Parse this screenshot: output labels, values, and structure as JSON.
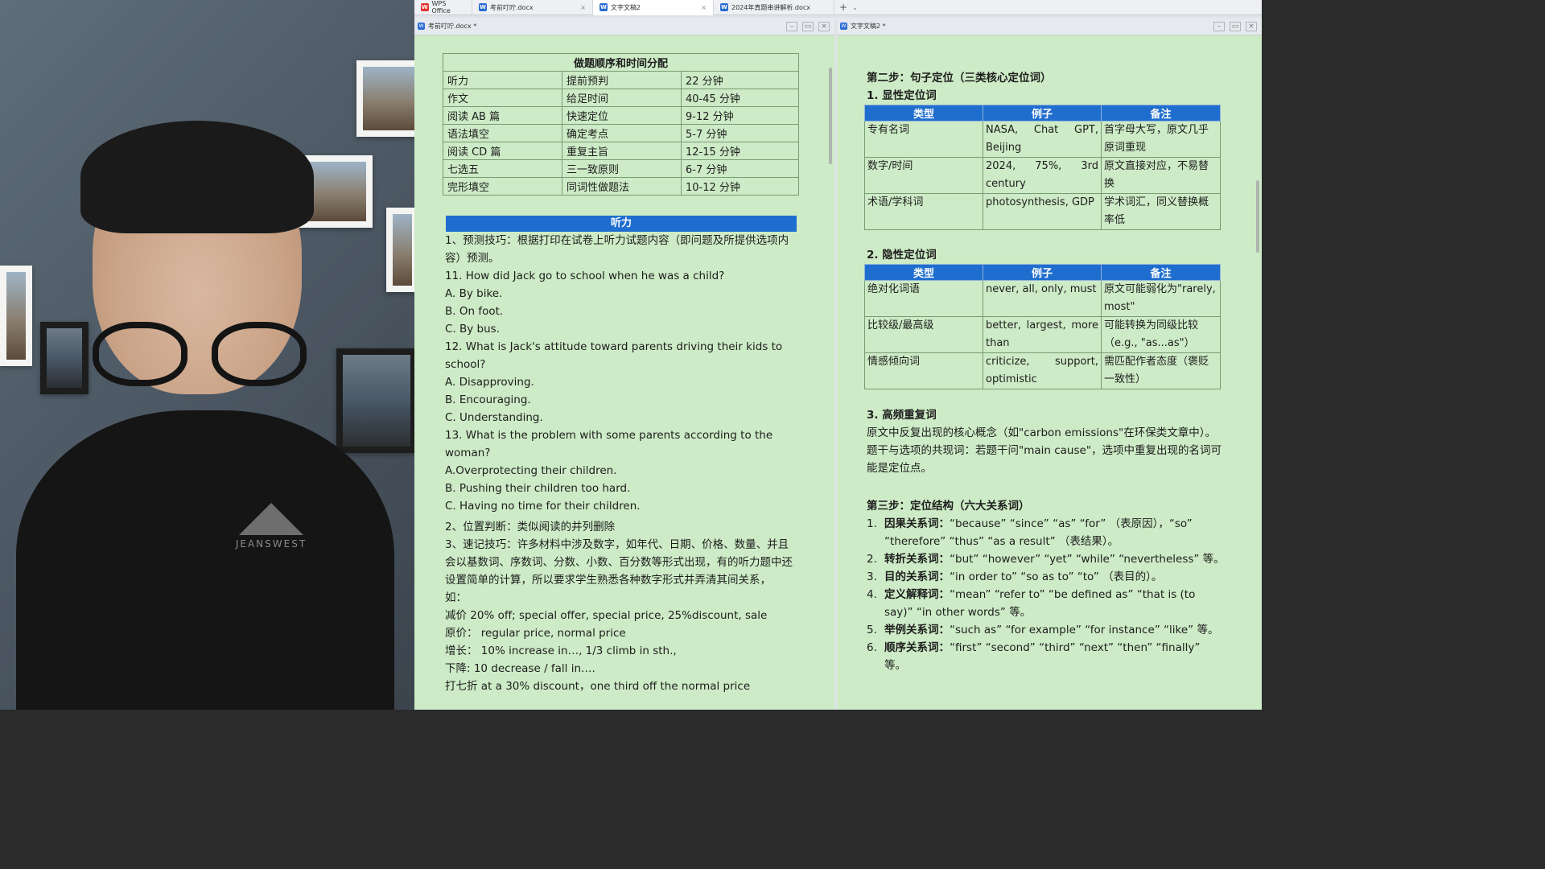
{
  "tabs": [
    {
      "label": "WPS Office",
      "icon": "wps-logo-icon"
    },
    {
      "label": "考前叮咛.docx",
      "icon": "word-doc-icon"
    },
    {
      "label": "文字文稿2",
      "icon": "word-doc-icon"
    },
    {
      "label": "2024年真题串讲解析.docx",
      "icon": "word-doc-icon"
    }
  ],
  "left_pane": {
    "title": "考前叮咛.docx *",
    "table": {
      "caption": "做题顺序和时间分配",
      "rows": [
        [
          "听力",
          "提前预判",
          "22 分钟"
        ],
        [
          "作文",
          "给足时间",
          "40-45 分钟"
        ],
        [
          "阅读 AB 篇",
          "快速定位",
          "9-12 分钟"
        ],
        [
          "语法填空",
          "确定考点",
          "5-7 分钟"
        ],
        [
          "阅读 CD 篇",
          "重复主旨",
          "12-15 分钟"
        ],
        [
          "七选五",
          "三一致原则",
          "6-7 分钟"
        ],
        [
          "完形填空",
          "同词性做题法",
          "10-12 分钟"
        ]
      ]
    },
    "section_bar": "听力",
    "lines": [
      "1、预测技巧：根据打印在试卷上听力试题内容（即问题及所提供选项内容）预测。",
      "11. How did Jack go to school when he was a child?",
      "A. By bike.",
      "B. On foot.",
      "C. By bus.",
      "12. What is Jack's attitude toward parents driving their kids to school?",
      "A. Disapproving.",
      "B. Encouraging.",
      "C. Understanding.",
      "13. What is the problem with some parents according to the woman?",
      "A.Overprotecting their children.",
      "B. Pushing their children too hard.",
      "C. Having no time for their children.",
      "2、位置判断：类似阅读的并列删除",
      "3、速记技巧：许多材料中涉及数字，如年代、日期、价格、数量、并且会以基数词、序数词、分数、小数、百分数等形式出现，有的听力题中还设置简单的计算，所以要求学生熟悉各种数字形式并弄清其间关系，",
      "如：",
      "减价 20% off; special offer, special price, 25%discount, sale",
      "原价： regular price, normal price",
      "增长： 10% increase in…, 1/3 climb in sth.,",
      "下降: 10 decrease / fall in….",
      "打七折 at a 30% discount，one third off the normal price"
    ]
  },
  "right_pane": {
    "title": "文字文稿2 *",
    "step2_title": "第二步：句子定位（三类核心定位词）",
    "explicit": {
      "heading": "1. 显性定位词",
      "headers": [
        "类型",
        "例子",
        "备注"
      ],
      "rows": [
        [
          "专有名词",
          "NASA, Chat GPT, Beijing",
          "首字母大写，原文几乎原词重现"
        ],
        [
          "数字/时间",
          "2024, 75%, 3rd century",
          "原文直接对应，不易替换"
        ],
        [
          "术语/学科词",
          "photosynthesis, GDP",
          "学术词汇，同义替换概率低"
        ]
      ]
    },
    "implicit": {
      "heading": "2. 隐性定位词",
      "headers": [
        "类型",
        "例子",
        "备注"
      ],
      "rows": [
        [
          "绝对化词语",
          "never, all, only, must",
          "原文可能弱化为\"rarely, most\""
        ],
        [
          "比较级/最高级",
          "better, largest, more than",
          "可能转换为同级比较（e.g., \"as...as\"）"
        ],
        [
          "情感倾向词",
          "criticize, support, optimistic",
          "需匹配作者态度（褒贬一致性）"
        ]
      ]
    },
    "frequent": {
      "heading": "3. 高频重复词",
      "p1": "原文中反复出现的核心概念（如\"carbon emissions\"在环保类文章中）。",
      "p2": "题干与选项的共现词：若题干问\"main cause\"，选项中重复出现的名词可能是定位点。"
    },
    "step3_title": "第三步：定位结构（六大关系词）",
    "relations": [
      {
        "num": "1.",
        "label": "因果关系词：",
        "text": "“because” “since” “as” “for” （表原因），“so” “therefore” “thus” “as a result” （表结果）。"
      },
      {
        "num": "2.",
        "label": "转折关系词：",
        "text": "“but” “however” “yet” “while” “nevertheless” 等。"
      },
      {
        "num": "3.",
        "label": "目的关系词：",
        "text": "“in order to” “so as to” “to” （表目的）。"
      },
      {
        "num": "4.",
        "label": "定义解释词：",
        "text": "“mean” “refer to” “be defined as” “that is (to say)” “in other words” 等。"
      },
      {
        "num": "5.",
        "label": "举例关系词：",
        "text": "“such as” “for example” “for instance” “like” 等。"
      },
      {
        "num": "6.",
        "label": "顺序关系词：",
        "text": "“first” “second” “third” “next” “then” “finally” 等。"
      }
    ]
  },
  "webcam": {
    "shirt_logo_text": "JEANSWEST"
  },
  "colors": {
    "doc_background": "#cdebc6",
    "accent_blue": "#1f6ecf",
    "tab_bar": "#eef0f3"
  }
}
